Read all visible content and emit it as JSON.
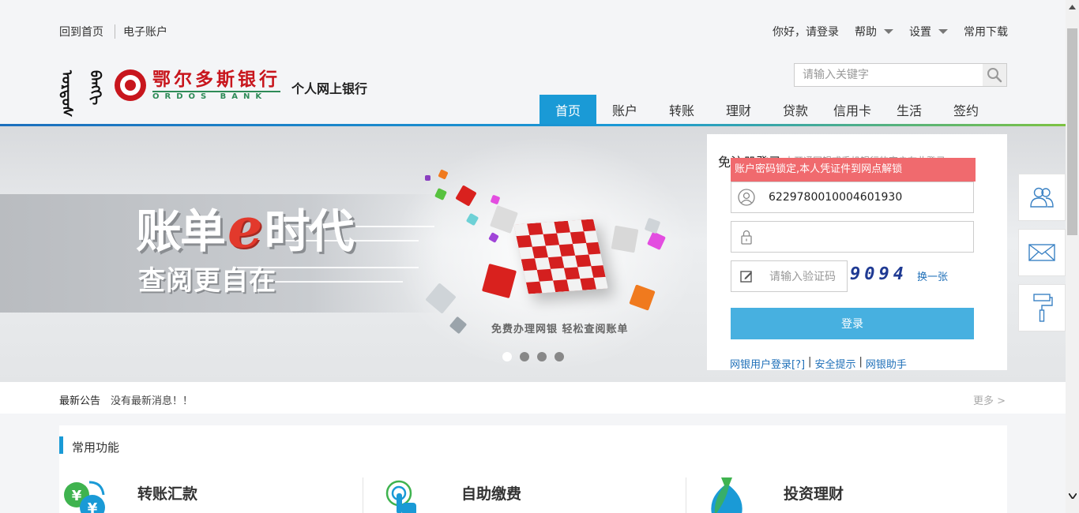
{
  "top_links": {
    "home": "回到首页",
    "account": "电子账户"
  },
  "user_links": {
    "greeting": "你好，请登录",
    "help": "帮助",
    "settings": "设置",
    "downloads": "常用下载"
  },
  "logo": {
    "mongolian_1": "ᠣᠷᠳᠣᠰ",
    "mongolian_2": "ᠪᠠᠩᠬᠢ",
    "bank_name_cn": "鄂尔多斯银行",
    "bank_name_en": "ORDOS BANK",
    "subtitle": "个人网上银行"
  },
  "search": {
    "placeholder": "请输入关键字"
  },
  "nav": {
    "items": [
      "首页",
      "账户",
      "转账",
      "理财",
      "贷款",
      "信用卡",
      "生活",
      "签约"
    ]
  },
  "banner": {
    "headline_left": "账单",
    "headline_e": "e",
    "headline_right": "时代",
    "tagline": "查阅更自在",
    "caption": "免费办理网银   轻松查阅账单",
    "slide_count": 4,
    "active_slide": 1
  },
  "login": {
    "heading": "免注册登录",
    "heading_hint": "未开通网银或手机银行的客户在此登录",
    "error_message": "账户密码锁定,本人凭证件到网点解锁",
    "account_value": "6229780010004601930",
    "password_value": "",
    "captcha_placeholder": "请输入验证码",
    "captcha_code": "9094",
    "refresh_label": "换一张",
    "login_button": "登录",
    "link_user_login": "网银用户登录[?]",
    "link_security": "安全提示",
    "link_helper": "网银助手"
  },
  "notice": {
    "label": "最新公告",
    "message": "没有最新消息！！",
    "more": "更多 >"
  },
  "common": {
    "title": "常用功能",
    "functions": [
      "转账汇款",
      "自助缴费",
      "投资理财"
    ]
  },
  "colors": {
    "primary": "#1a9ad6",
    "brand_red": "#c8161d",
    "brand_green": "#2e8b57",
    "error": "#f06a6e",
    "login_button": "#47b0e0"
  },
  "icons": {
    "side_tools": [
      "users-icon",
      "mail-icon",
      "paint-roller-icon"
    ]
  }
}
